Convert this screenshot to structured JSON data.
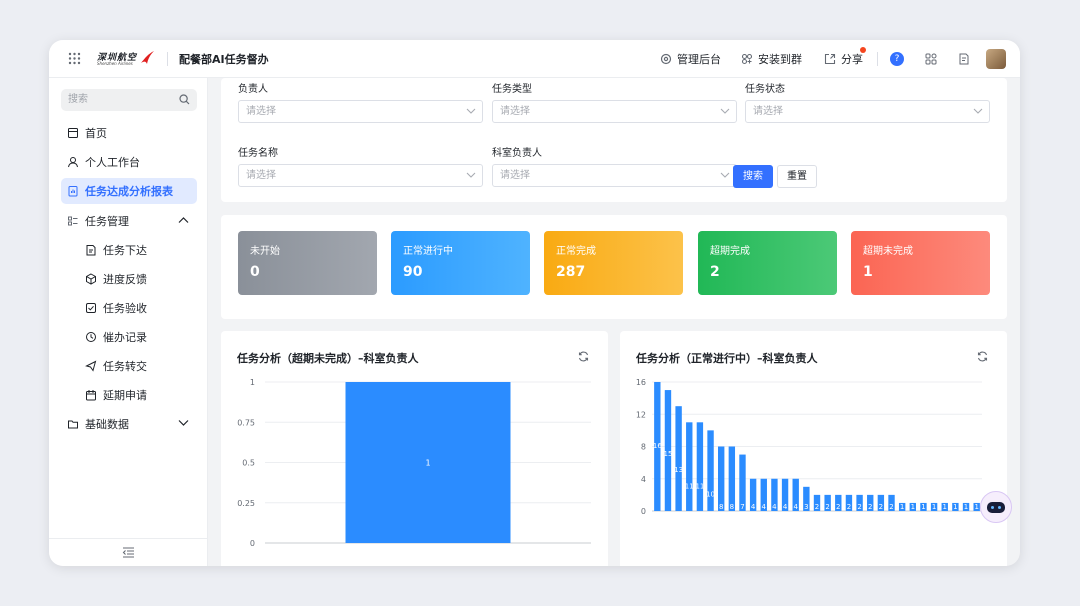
{
  "header": {
    "app_title": "配餐部AI任务督办",
    "logo_cn": "深圳航空",
    "logo_en": "Shenzhen Airlines",
    "admin": "管理后台",
    "install": "安装到群",
    "share": "分享",
    "help": "?"
  },
  "sidebar": {
    "search_placeholder": "搜索",
    "items": [
      {
        "label": "首页"
      },
      {
        "label": "个人工作台"
      },
      {
        "label": "任务达成分析报表"
      },
      {
        "label": "任务管理"
      },
      {
        "label": "任务下达"
      },
      {
        "label": "进度反馈"
      },
      {
        "label": "任务验收"
      },
      {
        "label": "催办记录"
      },
      {
        "label": "任务转交"
      },
      {
        "label": "延期申请"
      },
      {
        "label": "基础数据"
      }
    ]
  },
  "filters": {
    "owner_label": "负责人",
    "type_label": "任务类型",
    "status_label": "任务状态",
    "name_label": "任务名称",
    "dept_owner_label": "科室负责人",
    "placeholder": "请选择",
    "search_btn": "搜索",
    "reset_btn": "重置"
  },
  "stats": [
    {
      "label": "未开始",
      "value": "0",
      "color": "#8a9099"
    },
    {
      "label": "正常进行中",
      "value": "90",
      "color": "#2b9bff"
    },
    {
      "label": "正常完成",
      "value": "287",
      "color": "#fbb01f"
    },
    {
      "label": "超期完成",
      "value": "2",
      "color": "#2ac25d"
    },
    {
      "label": "超期未完成",
      "value": "1",
      "color": "#fb6d5c"
    }
  ],
  "chart_data": [
    {
      "type": "bar",
      "title": "任务分析（超期未完成）–科室负责人",
      "ylim": [
        0,
        1
      ],
      "yticks": [
        "1",
        "0.75",
        "0.5",
        "0.25",
        "0"
      ],
      "categories": [
        ""
      ],
      "values": [
        1
      ],
      "bar_color": "#2b8cff"
    },
    {
      "type": "bar",
      "title": "任务分析（正常进行中）–科室负责人",
      "ylim": [
        0,
        16
      ],
      "yticks": [
        "16",
        "12",
        "8",
        "4",
        "0"
      ],
      "values": [
        16,
        15,
        13,
        11,
        11,
        10,
        8,
        8,
        7,
        4,
        4,
        4,
        4,
        4,
        3,
        2,
        2,
        2,
        2,
        2,
        2,
        2,
        2,
        1,
        1,
        1,
        1,
        1,
        1,
        1,
        1
      ],
      "bar_color": "#2b8cff"
    }
  ]
}
